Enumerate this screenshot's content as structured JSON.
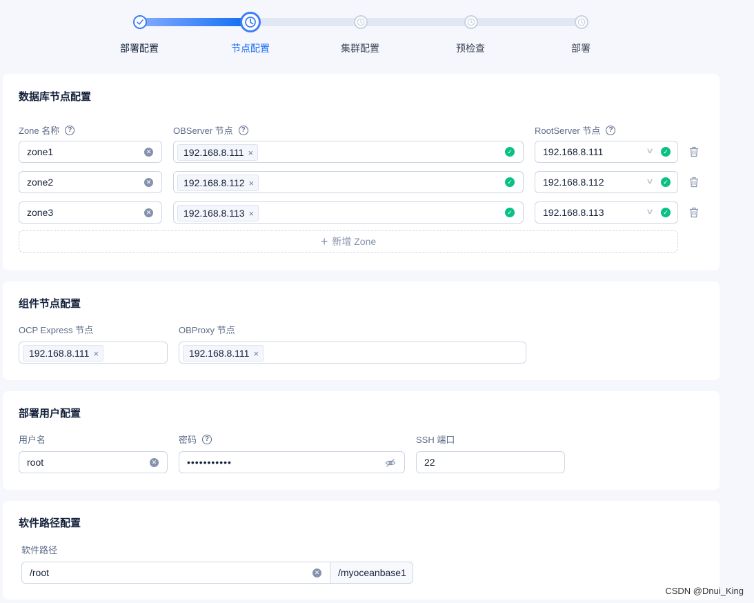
{
  "stepper": {
    "steps": [
      {
        "label": "部署配置",
        "state": "done"
      },
      {
        "label": "节点配置",
        "state": "current"
      },
      {
        "label": "集群配置",
        "state": "pending"
      },
      {
        "label": "预检查",
        "state": "pending"
      },
      {
        "label": "部署",
        "state": "pending"
      }
    ]
  },
  "db_nodes": {
    "title": "数据库节点配置",
    "zone_label": "Zone 名称",
    "observer_label": "OBServer 节点",
    "rootserver_label": "RootServer 节点",
    "rows": [
      {
        "zone": "zone1",
        "observer": "192.168.8.111",
        "rootserver": "192.168.8.111"
      },
      {
        "zone": "zone2",
        "observer": "192.168.8.112",
        "rootserver": "192.168.8.112"
      },
      {
        "zone": "zone3",
        "observer": "192.168.8.113",
        "rootserver": "192.168.8.113"
      }
    ],
    "add_zone_label": "新增 Zone"
  },
  "component_nodes": {
    "title": "组件节点配置",
    "ocp_label": "OCP Express 节点",
    "ocp_value": "192.168.8.111",
    "obproxy_label": "OBProxy 节点",
    "obproxy_value": "192.168.8.111"
  },
  "deploy_user": {
    "title": "部署用户配置",
    "username_label": "用户名",
    "username_value": "root",
    "password_label": "密码",
    "password_value": "•••••••••••",
    "ssh_label": "SSH 端口",
    "ssh_value": "22"
  },
  "software_path": {
    "title": "软件路径配置",
    "label": "软件路径",
    "value": "/root",
    "suffix": "/myoceanbase1"
  },
  "watermark": "CSDN @Dnui_King",
  "colors": {
    "primary": "#1a6cf6",
    "success": "#0ac185",
    "border": "#cdd5e4",
    "background": "#f5f7fc"
  }
}
